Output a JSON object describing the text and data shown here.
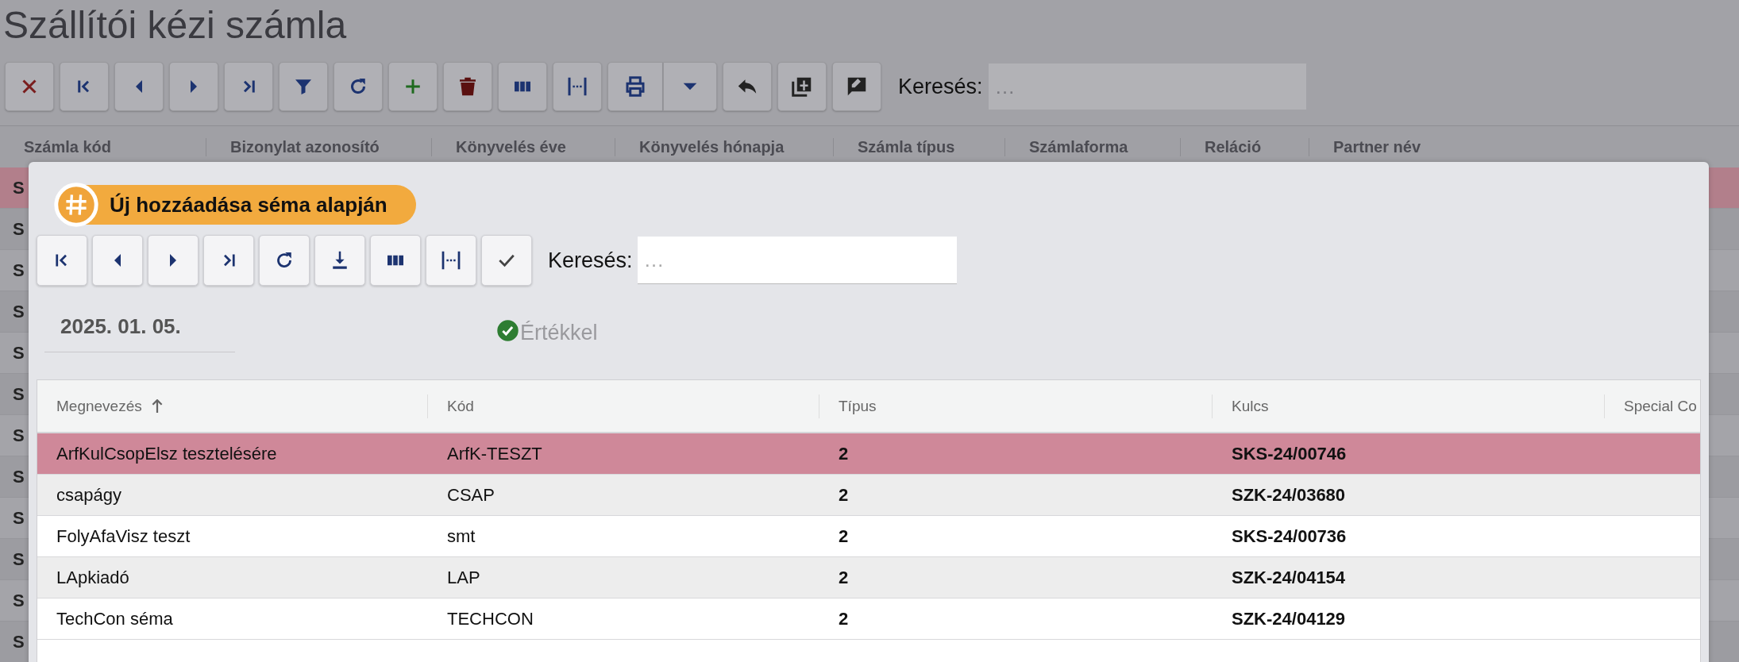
{
  "page": {
    "title": "Szállítói kézi számla"
  },
  "search": {
    "label": "Keresés:",
    "placeholder": "…"
  },
  "table": {
    "columns": [
      "Számla kód",
      "Bizonylat azonosító",
      "Könyvelés éve",
      "Könyvelés hónapja",
      "Számla típus",
      "Számlaforma",
      "Reláció",
      "Partner név"
    ],
    "rows": [
      {
        "cell": "S",
        "selected": true
      },
      {
        "cell": "S",
        "selected": false
      },
      {
        "cell": "S",
        "selected": false
      },
      {
        "cell": "S",
        "selected": false
      },
      {
        "cell": "S",
        "selected": false
      },
      {
        "cell": "S",
        "selected": false
      },
      {
        "cell": "S",
        "selected": false
      },
      {
        "cell": "S",
        "selected": false
      },
      {
        "cell": "S",
        "selected": false
      },
      {
        "cell": "S",
        "selected": false
      },
      {
        "cell": "S",
        "selected": false
      },
      {
        "cell": "S",
        "selected": false
      }
    ]
  },
  "dialog": {
    "title": "Új hozzáadása séma alapján",
    "search": {
      "label": "Keresés:",
      "placeholder": "…"
    },
    "date": "2025. 01. 05.",
    "option": {
      "label": "Értékkel",
      "checked": true
    },
    "table": {
      "columns": [
        {
          "label": "Megnevezés",
          "sorted": true
        },
        {
          "label": "Kód",
          "sorted": false
        },
        {
          "label": "Típus",
          "sorted": false
        },
        {
          "label": "Kulcs",
          "sorted": false
        },
        {
          "label": "Special Co",
          "sorted": false
        }
      ],
      "rows": [
        {
          "name": "ArfKulCsopElsz tesztelésére",
          "code": "ArfK-TESZT",
          "type": "2",
          "key": "SKS-24/00746",
          "selected": true
        },
        {
          "name": "csapágy",
          "code": "CSAP",
          "type": "2",
          "key": "SZK-24/03680",
          "selected": false
        },
        {
          "name": "FolyAfaVisz teszt",
          "code": "smt",
          "type": "2",
          "key": "SKS-24/00736",
          "selected": false
        },
        {
          "name": "LApkiadó",
          "code": "LAP",
          "type": "2",
          "key": "SZK-24/04154",
          "selected": false
        },
        {
          "name": "TechCon séma",
          "code": "TECHCON",
          "type": "2",
          "key": "SZK-24/04129",
          "selected": false
        }
      ]
    }
  }
}
